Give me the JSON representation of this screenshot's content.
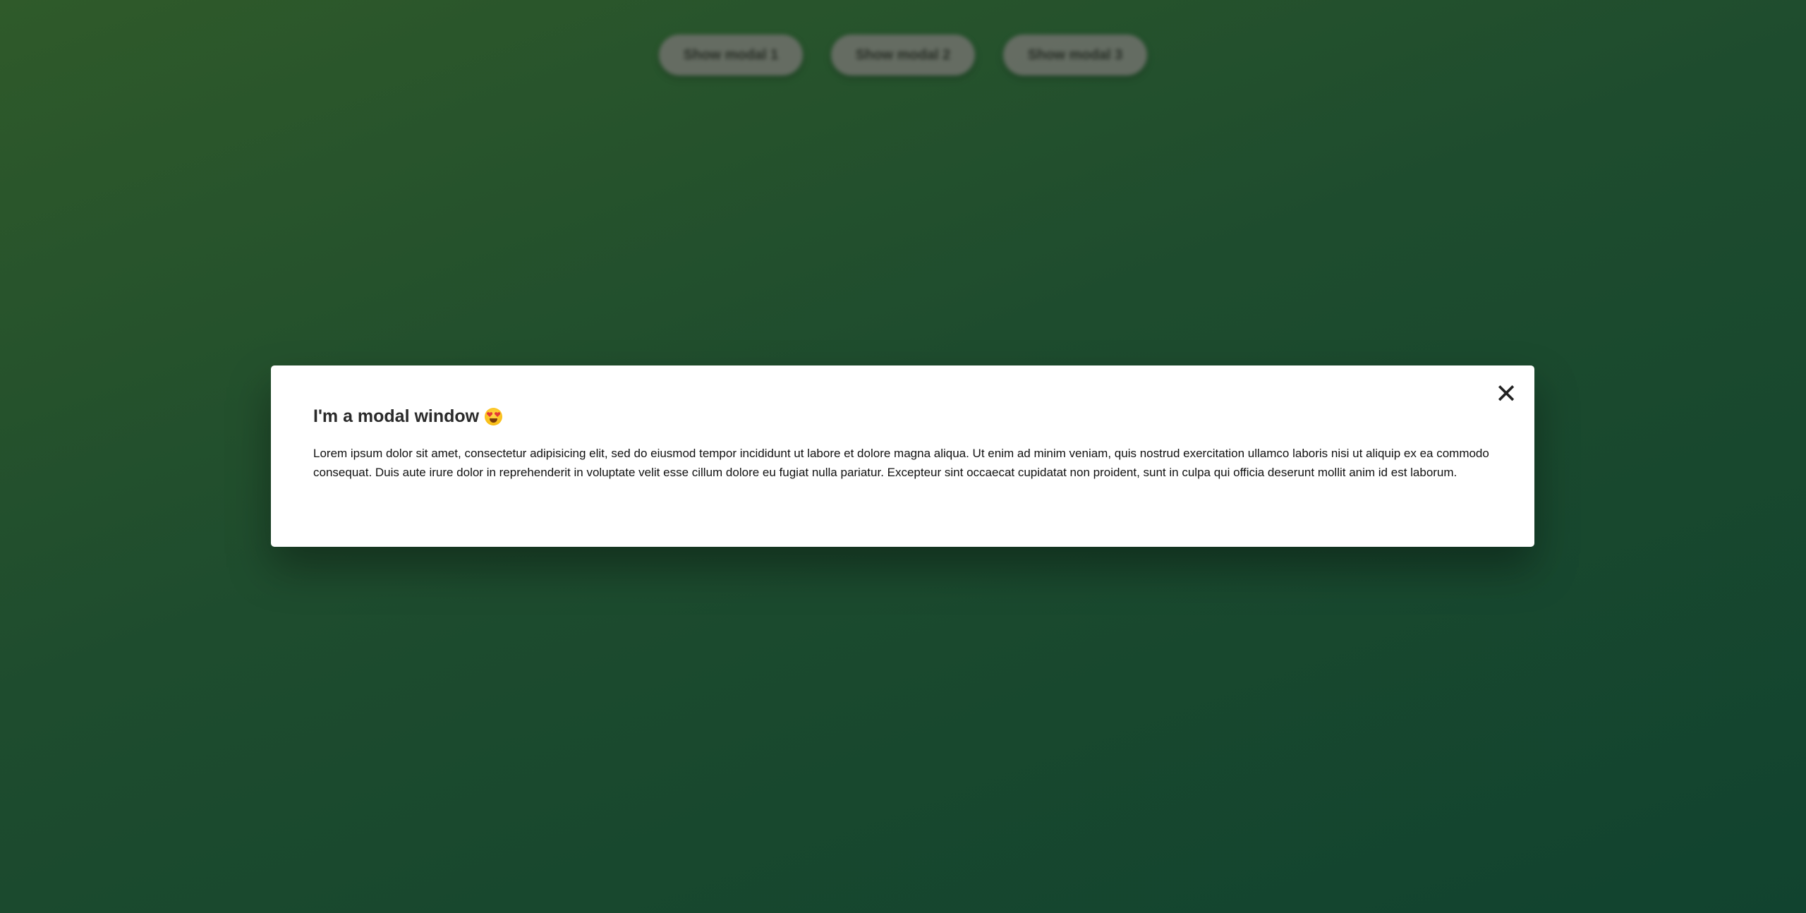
{
  "buttons": [
    {
      "label": "Show modal 1"
    },
    {
      "label": "Show modal 2"
    },
    {
      "label": "Show modal 3"
    }
  ],
  "modal": {
    "close_label": "✕",
    "title": "I'm a modal window",
    "title_emoji_icon": "heart-eyes-emoji-icon",
    "body": "Lorem ipsum dolor sit amet, consectetur adipisicing elit, sed do eiusmod tempor incididunt ut labore et dolore magna aliqua. Ut enim ad minim veniam, quis nostrud exercitation ullamco laboris nisi ut aliquip ex ea commodo consequat. Duis aute irure dolor in reprehenderit in voluptate velit esse cillum dolore eu fugiat nulla pariatur. Excepteur sint occaecat cupidatat non proident, sunt in culpa qui officia deserunt mollit anim id est laborum."
  },
  "colors": {
    "background_start": "#2f5a2a",
    "background_end": "#11432f",
    "modal_bg": "#ffffff",
    "button_bg": "#6b6f68"
  }
}
